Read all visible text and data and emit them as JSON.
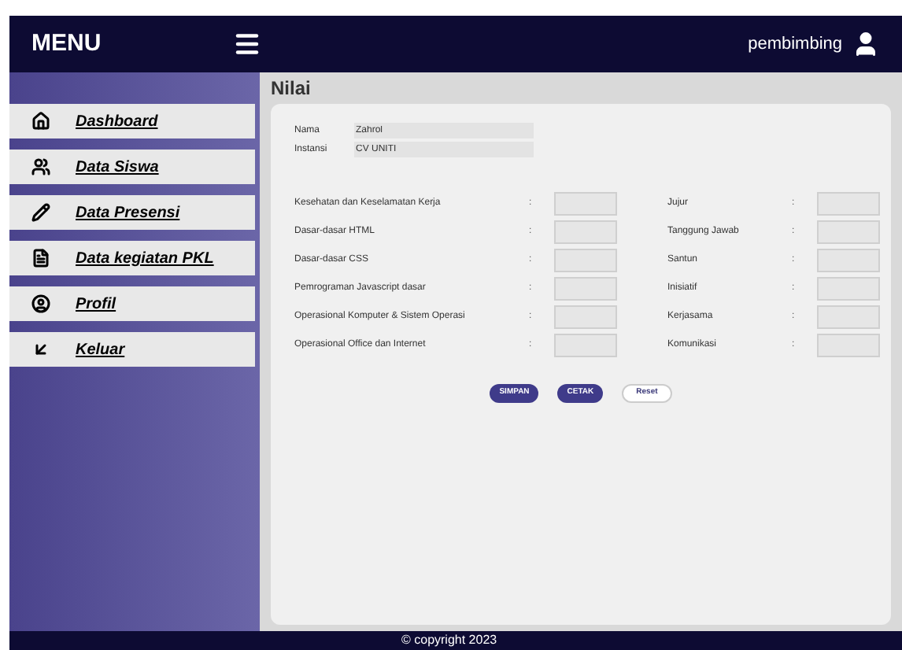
{
  "header": {
    "title": "MENU",
    "user": "pembimbing"
  },
  "sidebar": {
    "items": [
      {
        "label": "Dashboard"
      },
      {
        "label": "Data Siswa"
      },
      {
        "label": "Data Presensi"
      },
      {
        "label": "Data kegiatan PKL"
      },
      {
        "label": "Profil"
      },
      {
        "label": "Keluar"
      }
    ]
  },
  "page_title": "Nilai",
  "identity": [
    {
      "label": "Nama",
      "value": "Zahrol"
    },
    {
      "label": "Instansi",
      "value": "CV UNITI"
    }
  ],
  "scores_left": [
    {
      "label": "Kesehatan dan Keselamatan Kerja",
      "sep": ":"
    },
    {
      "label": "Dasar-dasar HTML",
      "sep": ":"
    },
    {
      "label": "Dasar-dasar CSS",
      "sep": ":"
    },
    {
      "label": "Pemrograman Javascript dasar",
      "sep": ":"
    },
    {
      "label": "Operasional Komputer & Sistem Operasi",
      "sep": ":"
    },
    {
      "label": "Operasional Office dan Internet",
      "sep": ":"
    }
  ],
  "scores_right": [
    {
      "label": "Jujur",
      "sep": ":"
    },
    {
      "label": "Tanggung Jawab",
      "sep": ":"
    },
    {
      "label": "Santun",
      "sep": ":"
    },
    {
      "label": "Inisiatif",
      "sep": ":"
    },
    {
      "label": "Kerjasama",
      "sep": ":"
    },
    {
      "label": "Komunikasi",
      "sep": ":"
    }
  ],
  "buttons": [
    {
      "label": "SIMPAN",
      "kind": "primary"
    },
    {
      "label": "CETAK",
      "kind": "primary"
    },
    {
      "label": "Reset",
      "kind": "outline"
    }
  ],
  "footer": "© copyright 2023"
}
